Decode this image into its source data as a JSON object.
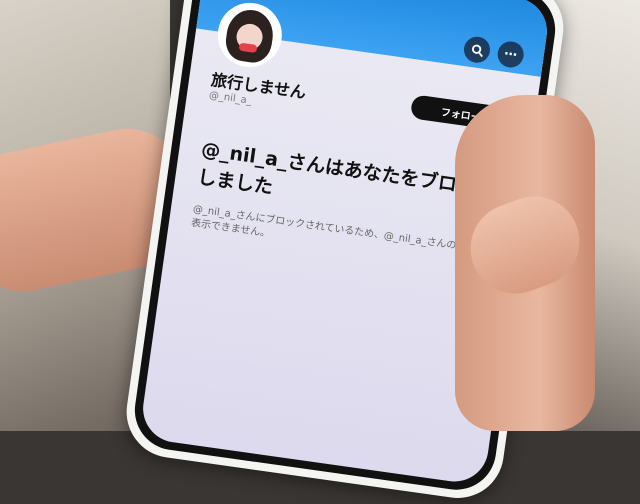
{
  "profile": {
    "display_name": "旅行しません",
    "handle": "@_nil_a_"
  },
  "header": {
    "search_icon": "search-icon",
    "more_icon": "more-icon"
  },
  "actions": {
    "follow_label": "フォローする"
  },
  "blocked": {
    "headline": "@_nil_a_さんはあなたをブロックしました",
    "message": "@_nil_a_さんにブロックされているため、@_nil_a_さんのポストを表示できません。"
  },
  "colors": {
    "banner": "#1f8ae0",
    "follow_button": "#111111"
  }
}
